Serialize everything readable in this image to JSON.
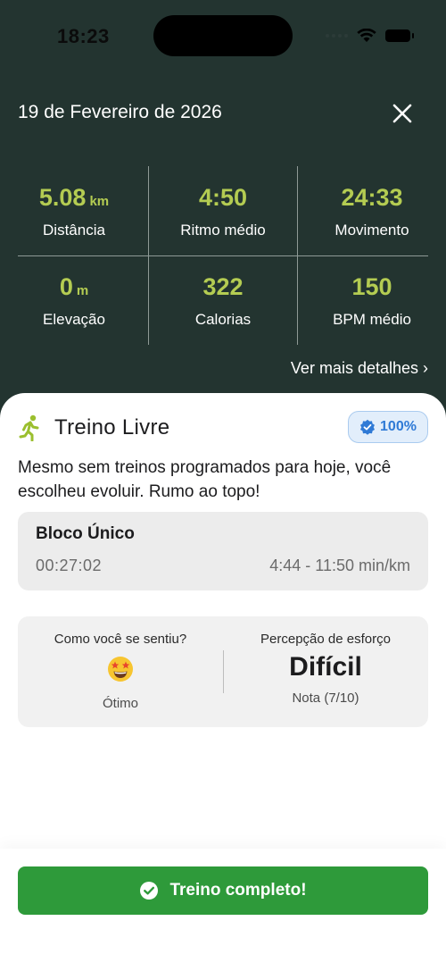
{
  "status_bar": {
    "time": "18:23"
  },
  "header": {
    "date": "19 de Fevereiro de 2026"
  },
  "stats": [
    {
      "value": "5.08",
      "unit": "km",
      "label": "Distância"
    },
    {
      "value": "4:50",
      "unit": "",
      "label": "Ritmo médio"
    },
    {
      "value": "24:33",
      "unit": "",
      "label": "Movimento"
    },
    {
      "value": "0",
      "unit": "m",
      "label": "Elevação"
    },
    {
      "value": "322",
      "unit": "",
      "label": "Calorias"
    },
    {
      "value": "150",
      "unit": "",
      "label": "BPM médio"
    }
  ],
  "more_details_label": "Ver mais detalhes ›",
  "workout": {
    "title": "Treino Livre",
    "badge": "100%",
    "description": "Mesmo sem treinos programados para hoje, você escolheu evoluir. Rumo ao topo!"
  },
  "block": {
    "title": "Bloco Único",
    "duration": "00:27:02",
    "pace_range": "4:44 - 11:50 min/km"
  },
  "feeling": {
    "question": "Como você se sentiu?",
    "answer": "Ótimo",
    "emoji": "star-struck-emoji"
  },
  "effort": {
    "question": "Percepção de esforço",
    "value": "Difícil",
    "note": "Nota (7/10)"
  },
  "complete_button": {
    "label": "Treino completo!"
  },
  "colors": {
    "background": "#233430",
    "accent": "#b4cc52",
    "success": "#2e9a3a",
    "badge": "#2f7ad6"
  }
}
